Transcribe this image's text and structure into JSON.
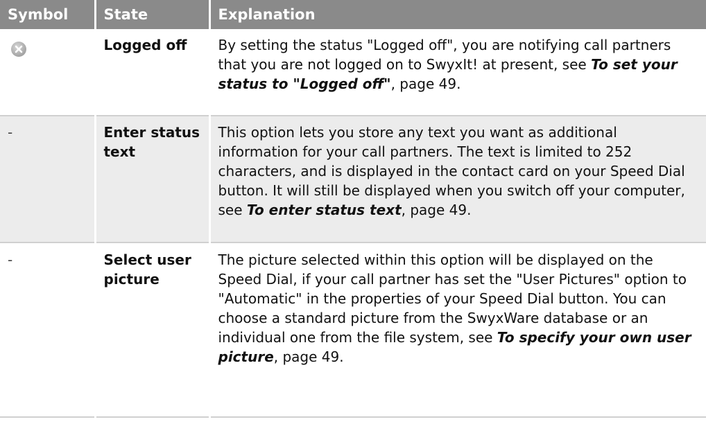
{
  "header": {
    "col_symbol": "Symbol",
    "col_state": "State",
    "col_explanation": "Explanation"
  },
  "rows": [
    {
      "symbol": "logged-off-icon",
      "state": "Logged off",
      "text_before": "By setting the status \"Logged off\", you are notifying call partners that you are not logged on to SwyxIt! at present, see ",
      "link": "To set your status to \"Logged off\"",
      "text_after": ", page 49."
    },
    {
      "symbol": "-",
      "state": "Enter status text",
      "text_before": "This option lets you store any text you want as additional information for your call partners. The text is limited to 252 characters, and is displayed in the contact card on your Speed Dial button. It will still be displayed when you switch off your computer, see ",
      "link": "To enter status text",
      "text_after": ", page 49."
    },
    {
      "symbol": "-",
      "state": "Select user picture",
      "text_before": "The picture selected within this option will be displayed on the Speed Dial, if your call partner has set the \"User Pictures\" option to \"Automatic\" in the properties of your Speed Dial button. You can choose a standard picture from the SwyxWare database or an individual one from the file system, see ",
      "link": "To specify your own user picture",
      "text_after": ", page 49."
    }
  ],
  "colors": {
    "header_bg": "#8a8a8a",
    "shaded_row_bg": "#ececec",
    "icon_gray": "#b4b4b4"
  }
}
